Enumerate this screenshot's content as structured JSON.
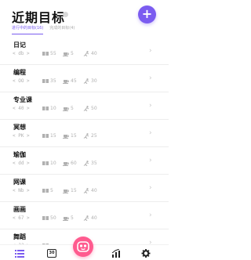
{
  "header": {
    "title": "近期目标",
    "add_label": "+"
  },
  "tabs": [
    {
      "label": "进行中的目标(16)",
      "active": true
    },
    {
      "label": "完成的目标(4)",
      "active": false
    }
  ],
  "goals": [
    {
      "name": "日记",
      "code": "< db >",
      "a": "55",
      "b": "5",
      "c": "40"
    },
    {
      "name": "编程",
      "code": "< OO >",
      "a": "35",
      "b": "45",
      "c": "30"
    },
    {
      "name": "专业课",
      "code": "< 40 >",
      "a": "10",
      "b": "5",
      "c": "50"
    },
    {
      "name": "冥想",
      "code": "< PK >",
      "a": "15",
      "b": "15",
      "c": "25"
    },
    {
      "name": "瑜伽",
      "code": "< dd >",
      "a": "10",
      "b": "60",
      "c": "35"
    },
    {
      "name": "网课",
      "code": "< Nb >",
      "a": "5",
      "b": "15",
      "c": "40"
    },
    {
      "name": "画画",
      "code": "< 67 >",
      "a": "50",
      "b": "5",
      "c": "40"
    },
    {
      "name": "舞蹈",
      "code": "< ?? >",
      "a": "",
      "b": "",
      "c": ""
    }
  ],
  "chevron": "›",
  "nav": {
    "calendar_day": "30",
    "icons": [
      "list-icon",
      "calendar-icon",
      "emoji-icon",
      "stats-icon",
      "settings-icon"
    ]
  },
  "colors": {
    "accent": "#7b5cf0",
    "center_button": "#ff5b8f"
  }
}
